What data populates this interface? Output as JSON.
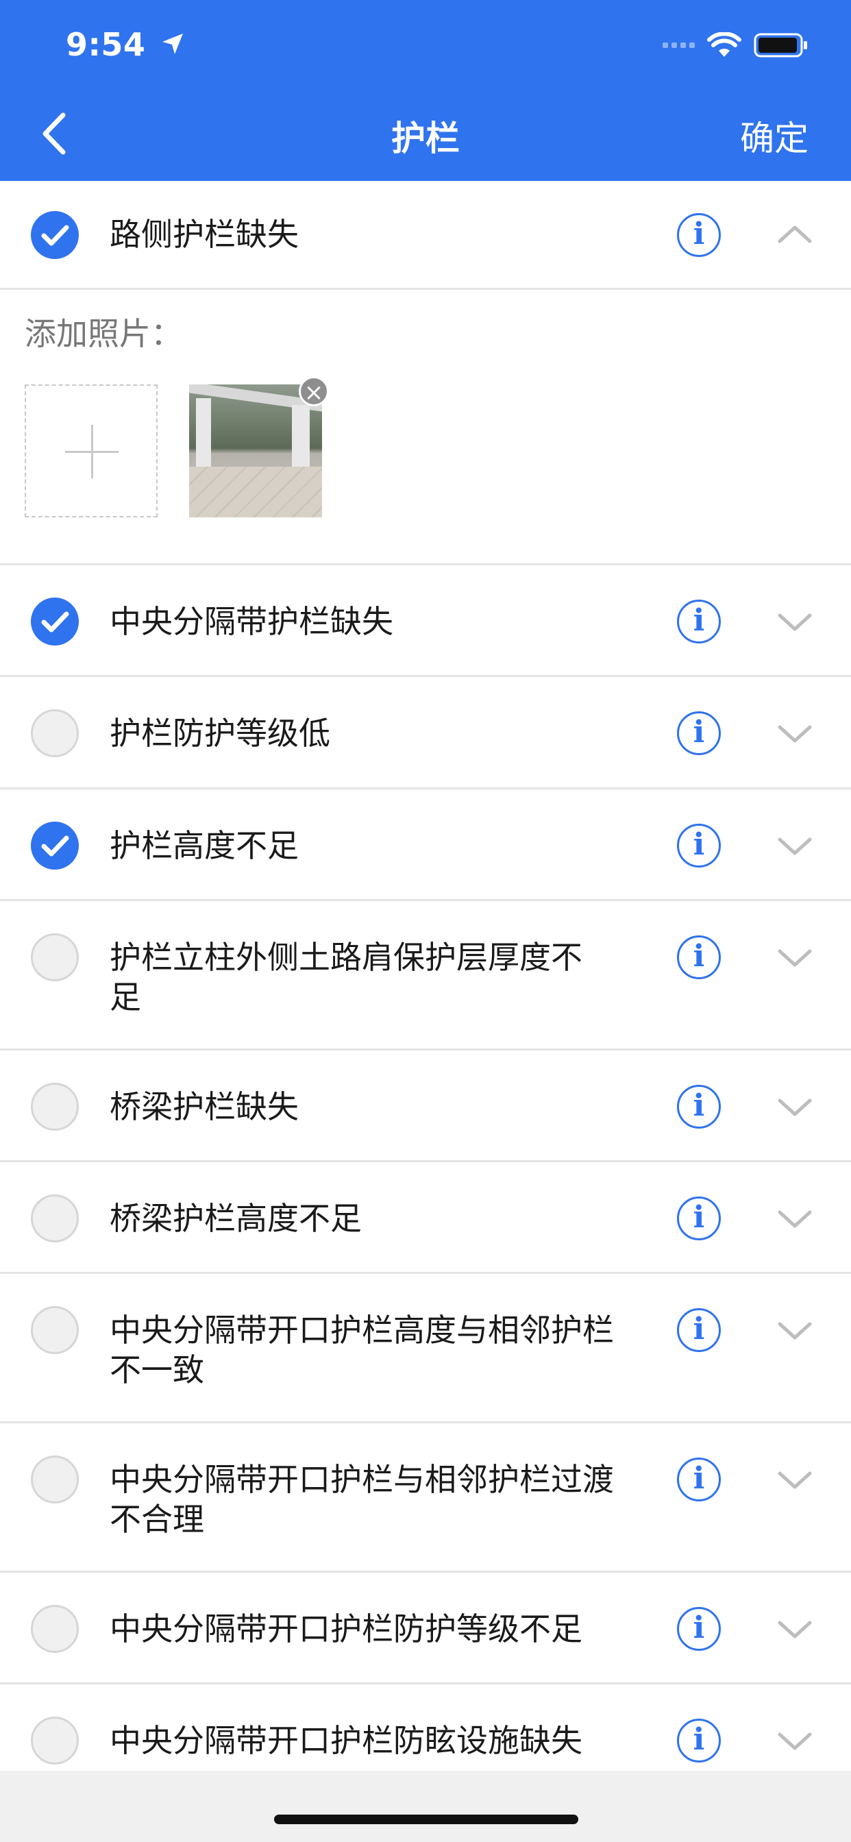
{
  "status_bar": {
    "time": "9:54",
    "location_arrow": "➤"
  },
  "nav": {
    "title": "护栏",
    "confirm": "确定"
  },
  "photo": {
    "label": "添加照片：",
    "add_symbol": "+",
    "remove_symbol": "×"
  },
  "items": [
    {
      "label": "路侧护栏缺失",
      "checked": true,
      "expanded": true,
      "info": "i"
    },
    {
      "label": "中央分隔带护栏缺失",
      "checked": true,
      "expanded": false,
      "info": "i"
    },
    {
      "label": "护栏防护等级低",
      "checked": false,
      "expanded": false,
      "info": "i"
    },
    {
      "label": "护栏高度不足",
      "checked": true,
      "expanded": false,
      "info": "i"
    },
    {
      "label": "护栏立柱外侧土路肩保护层厚度不足",
      "checked": false,
      "expanded": false,
      "info": "i"
    },
    {
      "label": "桥梁护栏缺失",
      "checked": false,
      "expanded": false,
      "info": "i"
    },
    {
      "label": "桥梁护栏高度不足",
      "checked": false,
      "expanded": false,
      "info": "i"
    },
    {
      "label": "中央分隔带开口护栏高度与相邻护栏不一致",
      "checked": false,
      "expanded": false,
      "info": "i"
    },
    {
      "label": "中央分隔带开口护栏与相邻护栏过渡不合理",
      "checked": false,
      "expanded": false,
      "info": "i"
    },
    {
      "label": "中央分隔带开口护栏防护等级不足",
      "checked": false,
      "expanded": false,
      "info": "i"
    },
    {
      "label": "中央分隔带开口护栏防眩设施缺失",
      "checked": false,
      "expanded": false,
      "info": "i"
    }
  ],
  "colors": {
    "primary": "#2f73ee",
    "divider": "#e4e4e4",
    "unchecked": "#f0f0f0"
  }
}
